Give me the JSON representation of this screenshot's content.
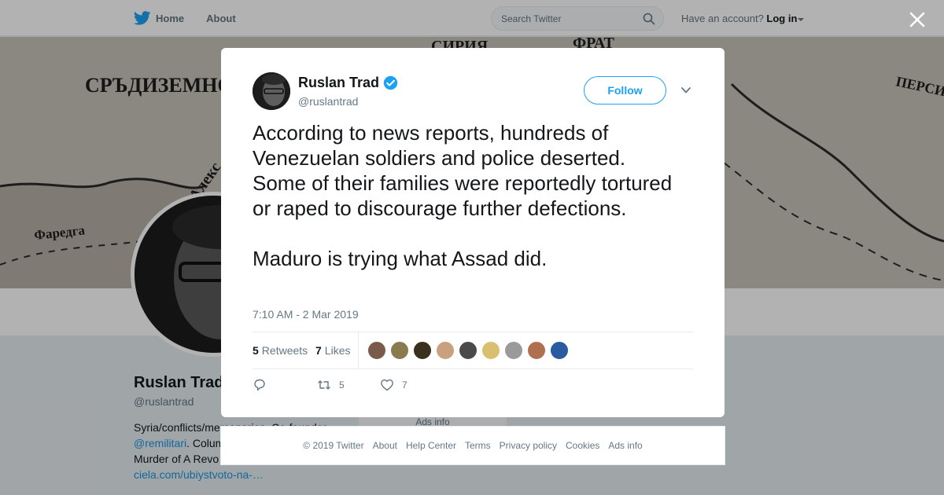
{
  "nav": {
    "home_label": "Home",
    "about_label": "About",
    "search_placeholder": "Search Twitter",
    "account_prompt": "Have an account?",
    "login_label": "Log in"
  },
  "banner": {
    "map_labels": [
      "СРЪДИЗЕМНО",
      "СИРИЯ",
      "ФРАТ",
      "ПЕРСИЯ",
      "Фаредга",
      "Алекс"
    ]
  },
  "background_profile": {
    "name": "Ruslan Trad",
    "handle": "@ruslantrad",
    "bio_line1": "Syria/conflicts/mercenaries. Co-founder",
    "bio_link": "@remilitari",
    "bio_line2": ". Colum",
    "bio_line3": "Murder of A Revo",
    "bio_url": "ciela.com/ubiystvoto-na-…",
    "card_label": "Ads info"
  },
  "tweet": {
    "name": "Ruslan Trad",
    "handle": "@ruslantrad",
    "follow_label": "Follow",
    "text": "According to news reports, hundreds of Venezuelan soldiers and police deserted. Some of their families were reportedly tortured or raped to discourage further defections.\n\nMaduro is trying what Assad did.",
    "timestamp": "7:10 AM - 2 Mar 2019",
    "retweets_count": "5",
    "retweets_label": "Retweets",
    "likes_count": "7",
    "likes_label": "Likes",
    "action_retweets": "5",
    "action_likes": "7",
    "liker_colors": [
      "#7a5a4a",
      "#8a7a50",
      "#3a3020",
      "#c9a080",
      "#4a4a4a",
      "#d8c070",
      "#9a9a9a",
      "#b07050",
      "#2a5aa0"
    ]
  },
  "footer": {
    "links": [
      "© 2019 Twitter",
      "About",
      "Help Center",
      "Terms",
      "Privacy policy",
      "Cookies",
      "Ads info"
    ]
  },
  "colors": {
    "accent": "#1da1f2",
    "text_secondary": "#657786"
  }
}
